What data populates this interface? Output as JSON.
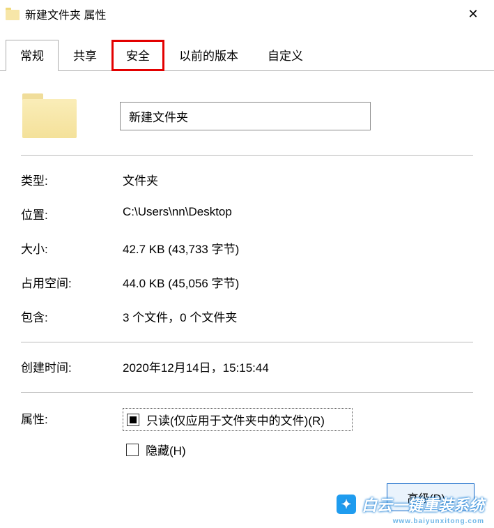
{
  "window": {
    "title": "新建文件夹 属性",
    "close": "✕"
  },
  "tabs": {
    "general": "常规",
    "sharing": "共享",
    "security": "安全",
    "previous": "以前的版本",
    "customize": "自定义"
  },
  "folder": {
    "name": "新建文件夹"
  },
  "props": {
    "type_label": "类型:",
    "type_value": "文件夹",
    "location_label": "位置:",
    "location_value": "C:\\Users\\nn\\Desktop",
    "size_label": "大小:",
    "size_value": "42.7 KB (43,733 字节)",
    "ondisk_label": "占用空间:",
    "ondisk_value": "44.0 KB (45,056 字节)",
    "contains_label": "包含:",
    "contains_value": "3 个文件，0 个文件夹",
    "created_label": "创建时间:",
    "created_value": "2020年12月14日，15:15:44"
  },
  "attrs": {
    "label": "属性:",
    "readonly": "只读(仅应用于文件夹中的文件)(R)",
    "hidden": "隐藏(H)",
    "advanced": "高级(D)..."
  },
  "watermark": {
    "text": "白云一键重装系统",
    "sub": "www.baiyunxitong.com"
  }
}
